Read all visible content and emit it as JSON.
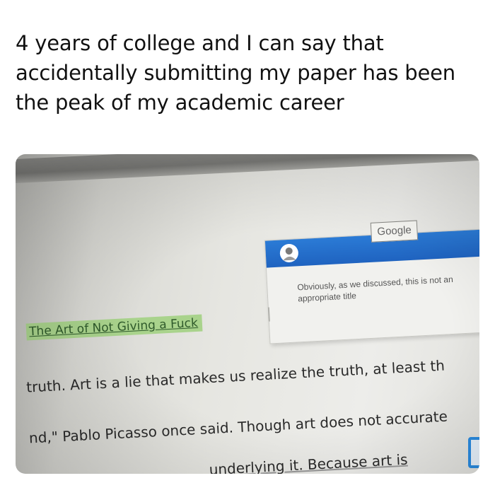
{
  "caption": {
    "line1": "4 years of college and I can say that",
    "line2": "accidentally submitting my paper has been",
    "line3": "the peak of my academic career"
  },
  "screen": {
    "comment": {
      "badge": "Google",
      "text_line1": "Obviously, as we discussed, this is not an",
      "text_line2": "appropriate title"
    },
    "document": {
      "title": "The Art of Not Giving a Fuck",
      "line1": "truth. Art is a lie that makes us realize the truth, at least th",
      "line2": "nd,\" Pablo Picasso once said. Though art does not accurate",
      "line3": "underlying it. Because art is"
    }
  },
  "colors": {
    "comment_header": "#1f63c0",
    "title_highlight": "#a9d38c",
    "blue_tab": "#2a8be0"
  }
}
